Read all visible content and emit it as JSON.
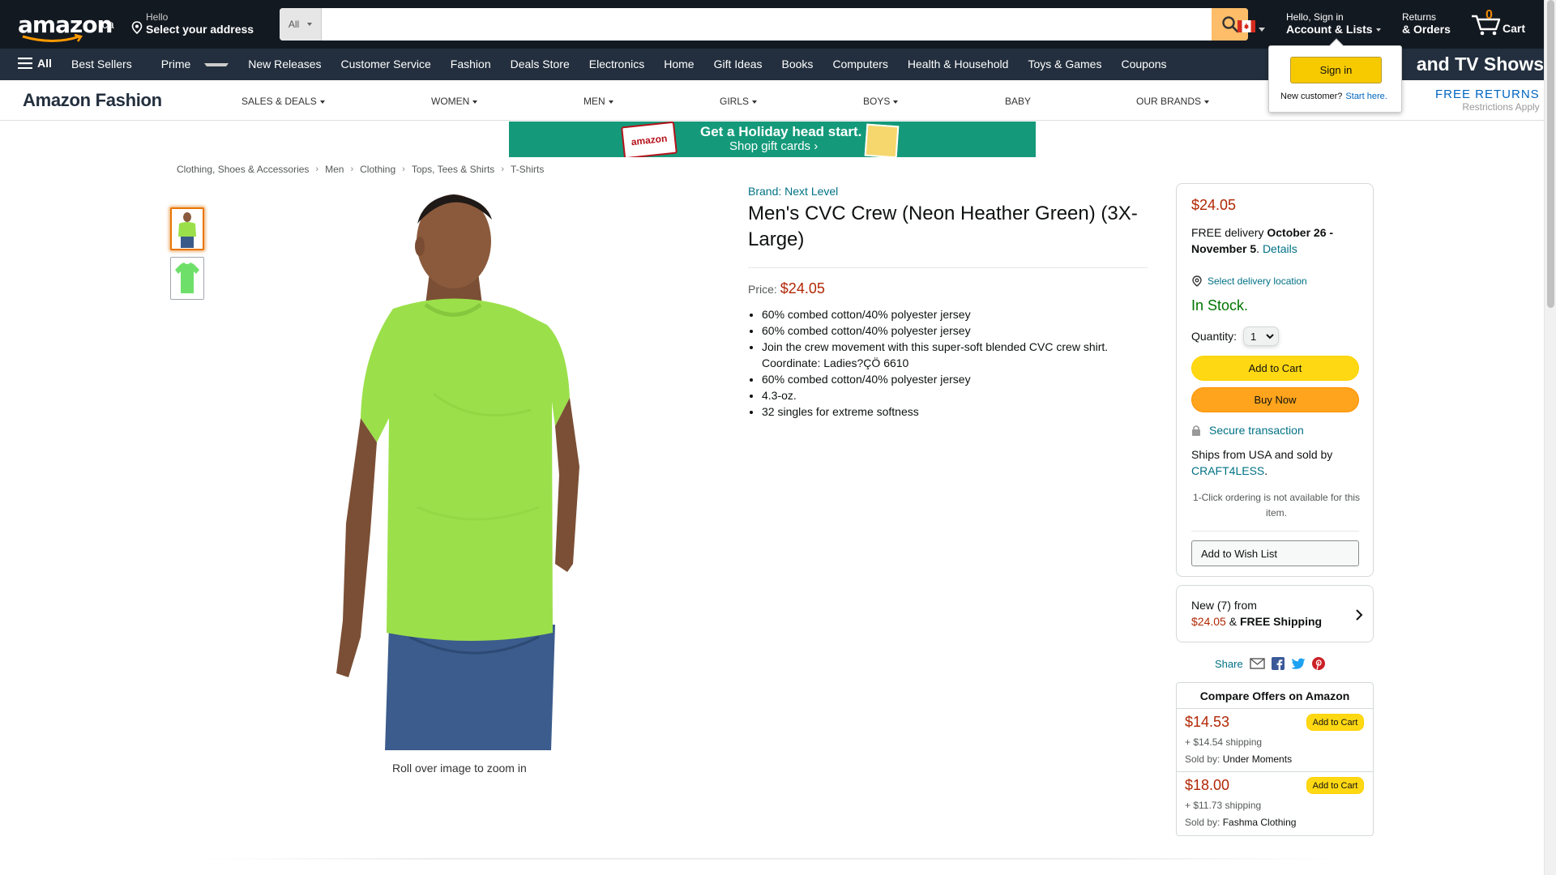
{
  "header": {
    "logo_text": "amazon",
    "logo_region": ".ca",
    "address_line1": "Hello",
    "address_line2": "Select your address",
    "search_category": "All",
    "search_placeholder": "",
    "account_line1": "Hello, Sign in",
    "account_line2": "Account & Lists",
    "returns_line1": "Returns",
    "returns_line2": "& Orders",
    "cart_count": "0",
    "cart_label": "Cart"
  },
  "subnav": {
    "all_label": "All",
    "items": [
      "Best Sellers",
      "Prime",
      "New Releases",
      "Customer Service",
      "Fashion",
      "Deals Store",
      "Electronics",
      "Home",
      "Gift Ideas",
      "Books",
      "Computers",
      "Health & Household",
      "Toys & Games",
      "Coupons"
    ],
    "promo": "and TV Shows"
  },
  "signin_flyout": {
    "button": "Sign in",
    "new_customer": "New customer?",
    "start_here": "Start here."
  },
  "fashion_nav": {
    "brand": "Amazon Fashion",
    "items": [
      "SALES & DEALS",
      "WOMEN",
      "MEN",
      "GIRLS",
      "BOYS",
      "BABY",
      "OUR BRANDS"
    ],
    "free_returns": "FREE RETURNS",
    "restrictions": "Restrictions Apply"
  },
  "banner": {
    "card_text": "amazon",
    "line1": "Get a Holiday head start.",
    "line2": "Shop gift cards ›"
  },
  "breadcrumb": [
    "Clothing, Shoes & Accessories",
    "Men",
    "Clothing",
    "Tops, Tees & Shirts",
    "T-Shirts"
  ],
  "gallery": {
    "rollover": "Roll over image to zoom in"
  },
  "product": {
    "brand": "Brand: Next Level",
    "title": "Men's CVC Crew (Neon Heather Green) (3X-Large)",
    "price_label": "Price:",
    "price": "$24.05",
    "bullets": [
      "60% combed cotton/40% polyester jersey",
      "60% combed cotton/40% polyester jersey",
      "Join the crew movement with this super-soft blended CVC crew shirt. Coordinate: Ladies?ÇÖ 6610",
      "60% combed cotton/40% polyester jersey",
      "4.3-oz.",
      "32 singles for extreme softness"
    ]
  },
  "buybox": {
    "price": "$24.05",
    "delivery_prefix": "FREE delivery",
    "delivery_dates": "October 26 - November 5",
    "details": "Details",
    "select_location": "Select delivery location",
    "stock": "In Stock.",
    "quantity_label": "Quantity:",
    "quantity_value": "1",
    "add_to_cart": "Add to Cart",
    "buy_now": "Buy Now",
    "secure": "Secure transaction",
    "ships_from": "Ships from USA and sold by",
    "seller": "CRAFT4LESS",
    "one_click": "1-Click ordering is not available for this item.",
    "wish_list": "Add to Wish List"
  },
  "new_offers": {
    "line1": "New (7) from",
    "price": "$24.05",
    "shipping": "FREE Shipping"
  },
  "share": {
    "label": "Share"
  },
  "compare": {
    "title": "Compare Offers on Amazon",
    "offers": [
      {
        "price": "$14.53",
        "shipping": "+ $14.54 shipping",
        "sold_by_label": "Sold by:",
        "seller": "Under Moments",
        "button": "Add to Cart"
      },
      {
        "price": "$18.00",
        "shipping": "+ $11.73 shipping",
        "sold_by_label": "Sold by:",
        "seller": "Fashma Clothing",
        "button": "Add to Cart"
      }
    ]
  },
  "colors": {
    "nav_dark": "#131921",
    "nav_secondary": "#232f3e",
    "price_red": "#b12704",
    "link_teal": "#007185",
    "stock_green": "#007600",
    "cart_yellow": "#ffd814",
    "buy_orange": "#ffa41c",
    "shirt_green": "#9be04a"
  }
}
